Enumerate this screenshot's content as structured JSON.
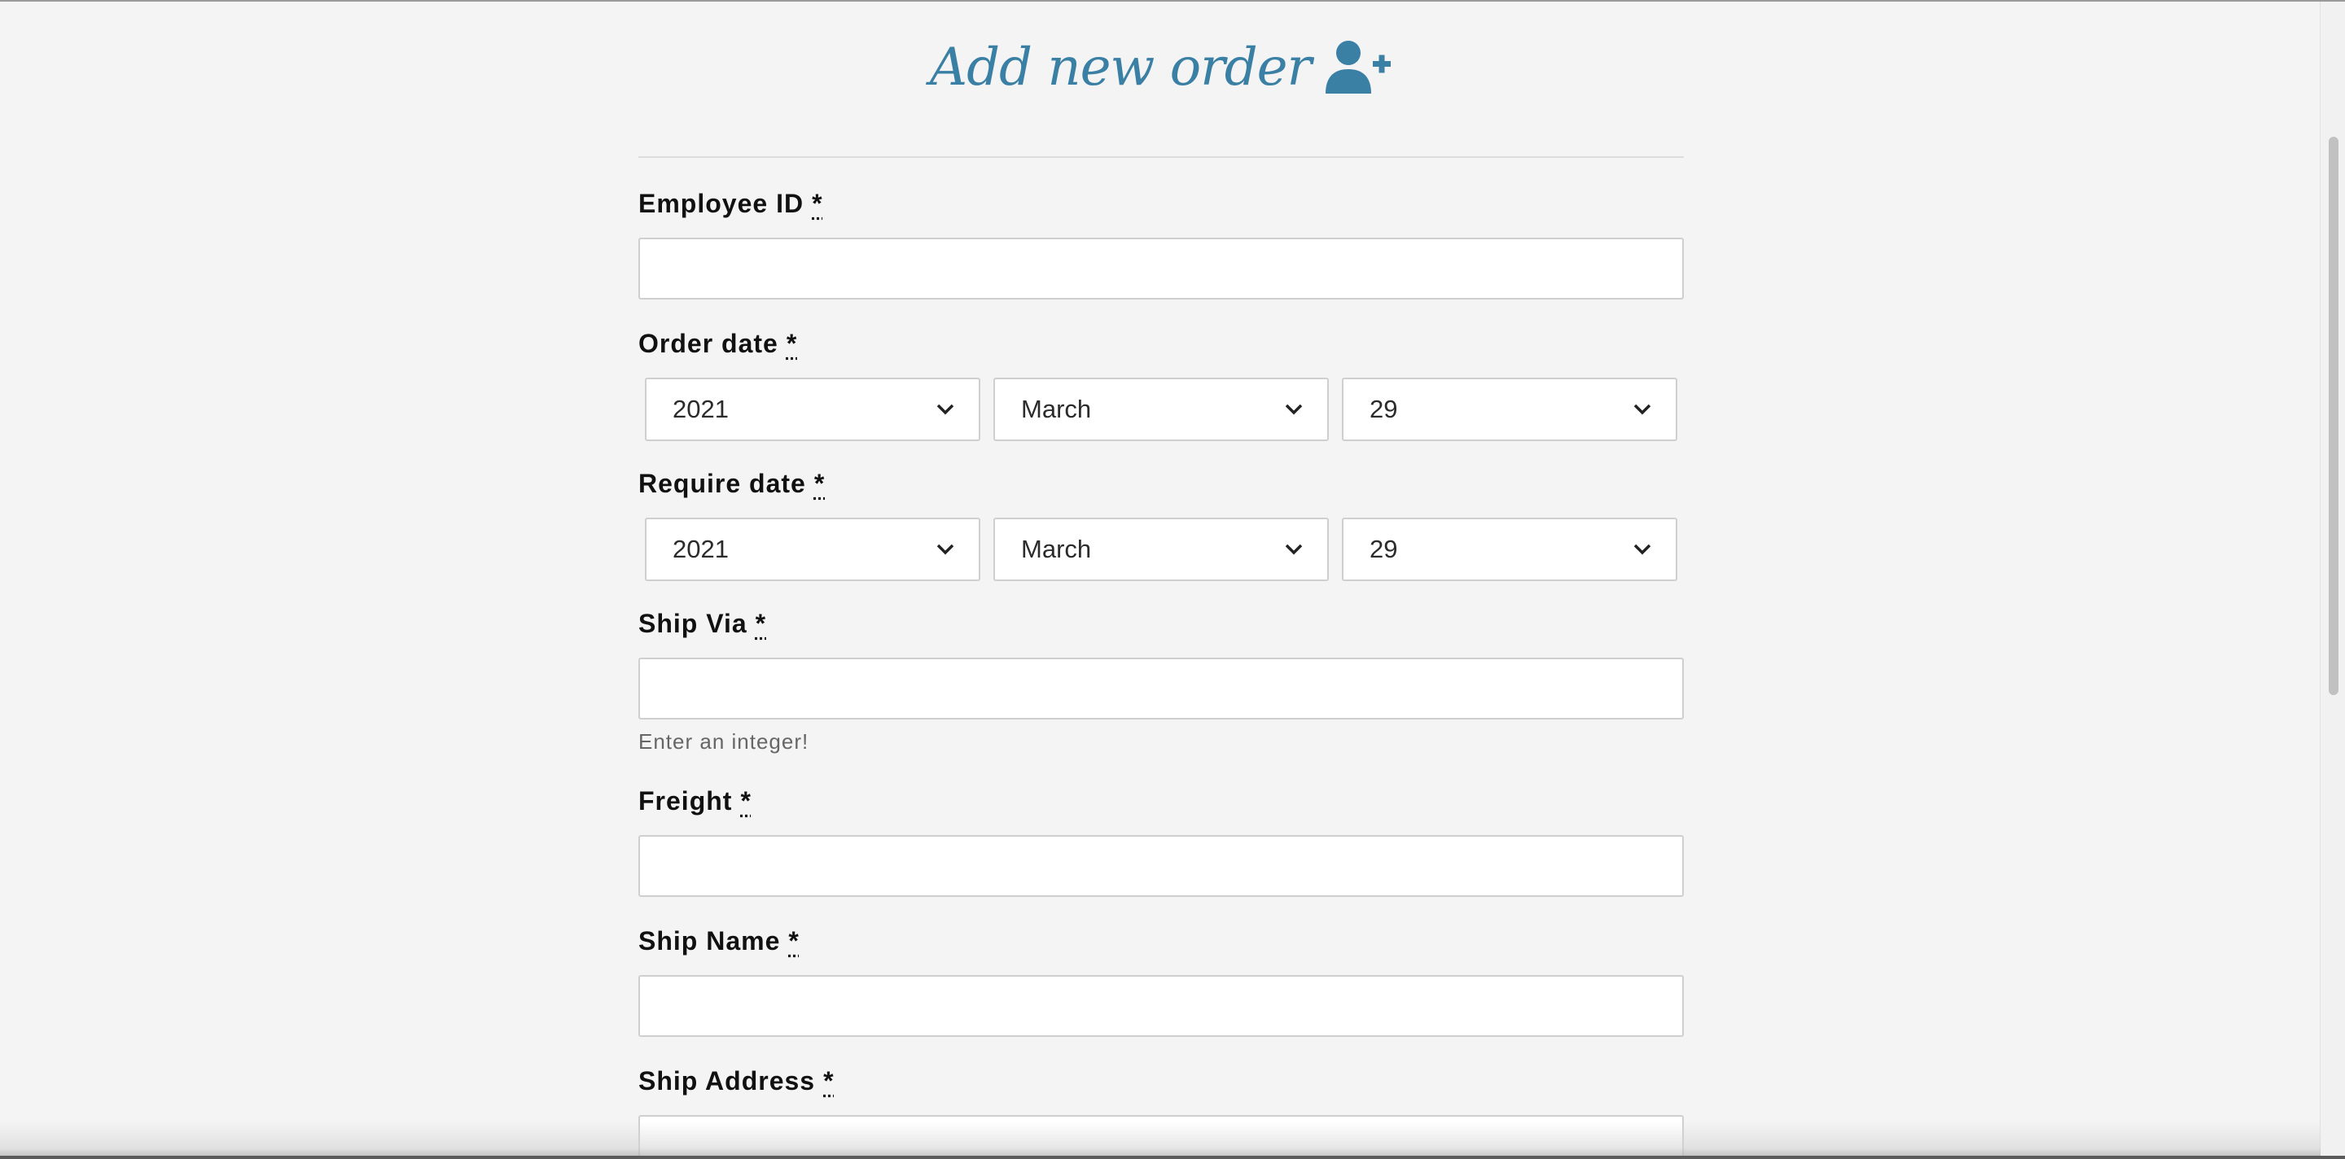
{
  "title": "Add new order",
  "icons": {
    "title_icon": "user-plus-icon",
    "select_arrow": "chevron-down-icon"
  },
  "colors": {
    "accent": "#3a7fa4",
    "background": "#f4f4f4",
    "input_border": "#cfcfcf"
  },
  "required_marker": "*",
  "fields": {
    "employee_id": {
      "label": "Employee ID",
      "value": ""
    },
    "order_date": {
      "label": "Order date",
      "year": "2021",
      "month": "March",
      "day": "29"
    },
    "require_date": {
      "label": "Require date",
      "year": "2021",
      "month": "March",
      "day": "29"
    },
    "ship_via": {
      "label": "Ship Via",
      "value": "",
      "help": "Enter an integer!"
    },
    "freight": {
      "label": "Freight",
      "value": ""
    },
    "ship_name": {
      "label": "Ship Name",
      "value": ""
    },
    "ship_address": {
      "label": "Ship Address",
      "value": ""
    }
  }
}
